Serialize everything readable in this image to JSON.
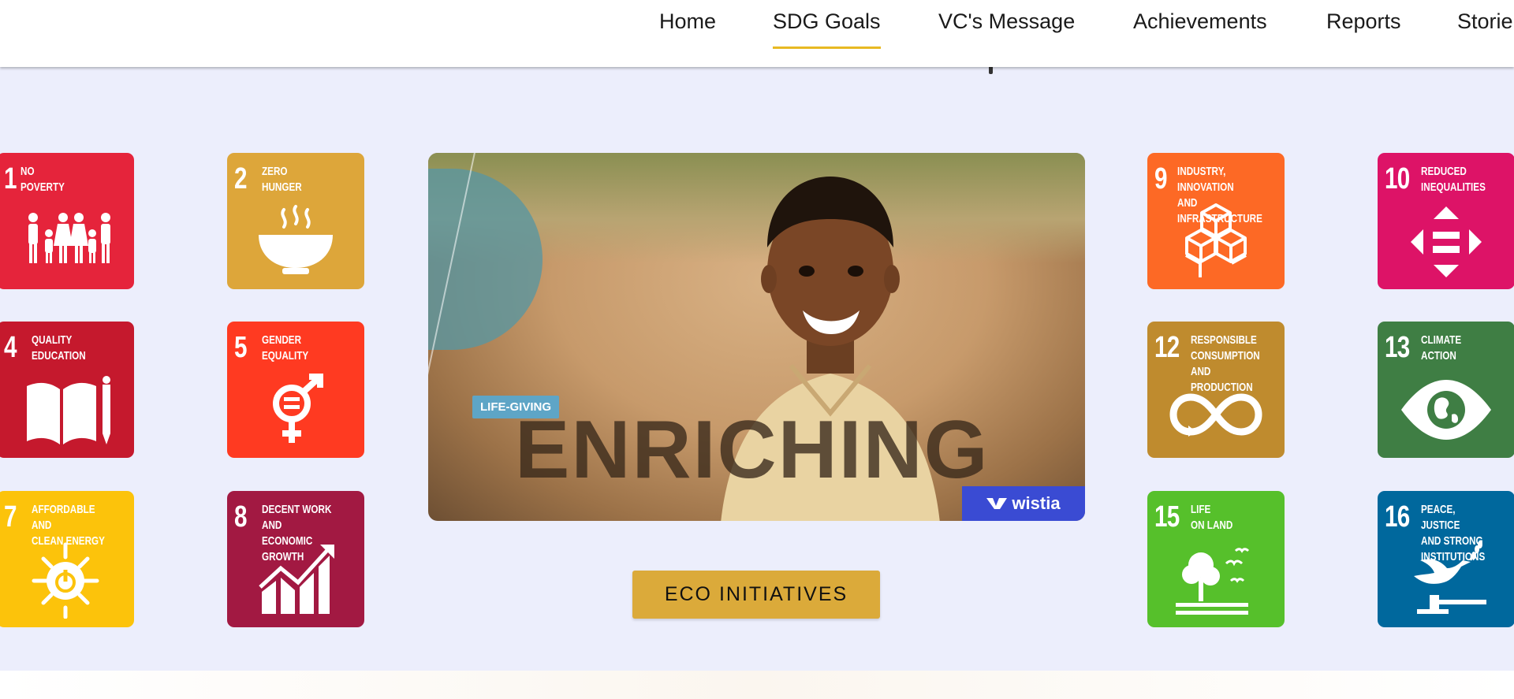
{
  "nav": {
    "items": [
      {
        "label": "Home",
        "active": false
      },
      {
        "label": "SDG Goals",
        "active": true
      },
      {
        "label": "VC's Message",
        "active": false
      },
      {
        "label": "Achievements",
        "active": false
      },
      {
        "label": "Reports",
        "active": false
      },
      {
        "label": "Storie",
        "active": false
      }
    ],
    "accent": "#e8b923"
  },
  "tiles": [
    {
      "num": "1",
      "label": "No\nPoverty",
      "color": "#e5243b",
      "icon": "family-icon"
    },
    {
      "num": "2",
      "label": "Zero\nHunger",
      "color": "#dda63a",
      "icon": "bowl-icon"
    },
    {
      "num": "4",
      "label": "Quality\nEducation",
      "color": "#c5192d",
      "icon": "book-pencil-icon"
    },
    {
      "num": "5",
      "label": "Gender\nEquality",
      "color": "#ff3a21",
      "icon": "gender-equality-icon"
    },
    {
      "num": "7",
      "label": "Affordable and\nClean Energy",
      "color": "#fcc30b",
      "icon": "sun-power-icon"
    },
    {
      "num": "8",
      "label": "Decent Work and\nEconomic Growth",
      "color": "#a21942",
      "icon": "growth-chart-icon"
    },
    {
      "num": "9",
      "label": "Industry, Innovation\nand Infrastructure",
      "color": "#fd6925",
      "icon": "cubes-icon"
    },
    {
      "num": "10",
      "label": "Reduced\nInequalities",
      "color": "#dd1367",
      "icon": "equality-arrows-icon"
    },
    {
      "num": "12",
      "label": "Responsible\nConsumption\nand Production",
      "color": "#bf8b2e",
      "icon": "infinity-icon"
    },
    {
      "num": "13",
      "label": "Climate\nAction",
      "color": "#3f7e44",
      "icon": "eye-globe-icon"
    },
    {
      "num": "15",
      "label": "Life\nOn Land",
      "color": "#56c02b",
      "icon": "tree-birds-icon"
    },
    {
      "num": "16",
      "label": "Peace, Justice\nand Strong\nInstitutions",
      "color": "#00689d",
      "icon": "dove-gavel-icon"
    }
  ],
  "video": {
    "tag": "LIFE-GIVING",
    "word": "ENRICHING",
    "brand": "wistia",
    "brand_color": "#3a4bd3"
  },
  "cta": {
    "label": "ECO INITIATIVES",
    "color": "#dbaa3a"
  }
}
